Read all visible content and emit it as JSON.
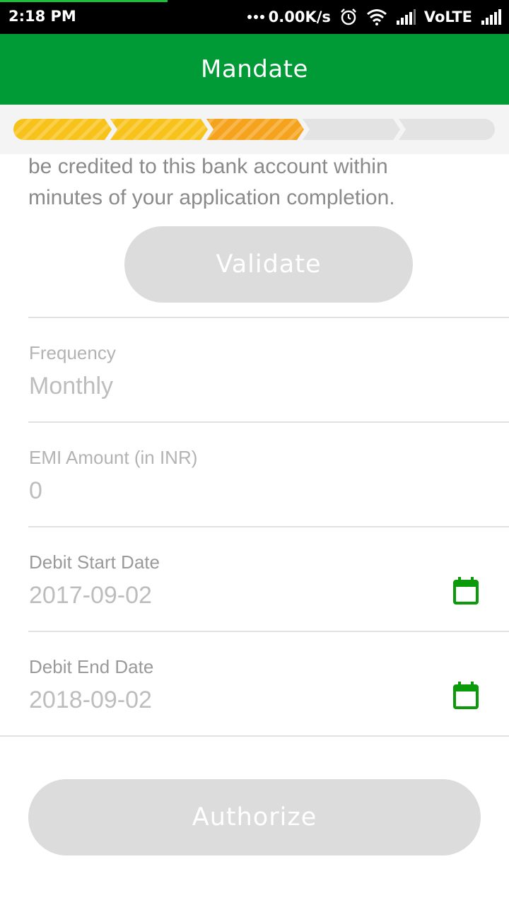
{
  "status_bar": {
    "time": "2:18 PM",
    "network_speed": "0.00K/s",
    "carrier": "VoLTE",
    "icons": [
      "more-dots-icon",
      "alarm-icon",
      "wifi-icon",
      "signal-icon",
      "signal-icon"
    ]
  },
  "header": {
    "title": "Mandate"
  },
  "stepper": {
    "total_steps": 5,
    "completed_steps": 2,
    "current_step": 3
  },
  "intro": {
    "line1": "be credited to this bank account within",
    "line2": "minutes of your application completion."
  },
  "buttons": {
    "validate": "Validate",
    "authorize": "Authorize"
  },
  "fields": {
    "frequency": {
      "label": "Frequency",
      "value": "Monthly"
    },
    "emi_amount": {
      "label": "EMI Amount (in INR)",
      "value": "0"
    },
    "debit_start": {
      "label": "Debit Start Date",
      "value": "2017-09-02",
      "icon": "calendar-icon"
    },
    "debit_end": {
      "label": "Debit End Date",
      "value": "2018-09-02",
      "icon": "calendar-icon"
    }
  },
  "colors": {
    "brand_green": "#009a36",
    "step_done": "#f7c21a",
    "step_current": "#f5a31c",
    "step_pending": "#e3e3e3",
    "button_disabled": "#dcdcdc"
  }
}
